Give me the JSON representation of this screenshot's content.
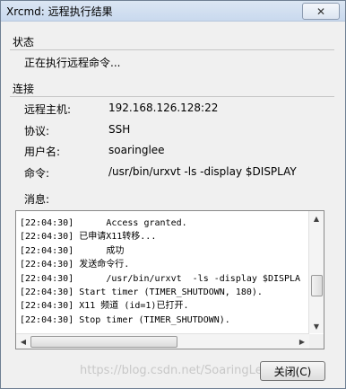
{
  "window": {
    "title": "Xrcmd: 远程执行结果",
    "close_glyph": "✕"
  },
  "status": {
    "heading": "状态",
    "text": "正在执行远程命令..."
  },
  "connection": {
    "heading": "连接",
    "fields": [
      {
        "label": "远程主机:",
        "value": "192.168.126.128:22"
      },
      {
        "label": "协议:",
        "value": "SSH"
      },
      {
        "label": "用户名:",
        "value": "soaringlee"
      },
      {
        "label": "命令:",
        "value": "/usr/bin/urxvt -ls -display $DISPLAY"
      }
    ]
  },
  "messages": {
    "label": "消息:",
    "lines": [
      "[22:04:30]      Access granted.",
      "[22:04:30] 已申请X11转移...",
      "[22:04:30]      成功",
      "[22:04:30] 发送命令行.",
      "[22:04:30]      /usr/bin/urxvt  -ls -display $DISPLA",
      "[22:04:30] Start timer (TIMER_SHUTDOWN, 180).",
      "[22:04:30] X11 频道 (id=1)已打开.",
      "[22:04:30] Stop timer (TIMER_SHUTDOWN)."
    ]
  },
  "scrollbars": {
    "vertical_position": 0.85,
    "horizontal_position": 0.0,
    "horizontal_visible_fraction": 0.55
  },
  "footer": {
    "close_button": "关闭(C)",
    "watermark": "https://blog.csdn.net/SoaringLee_fighting"
  }
}
